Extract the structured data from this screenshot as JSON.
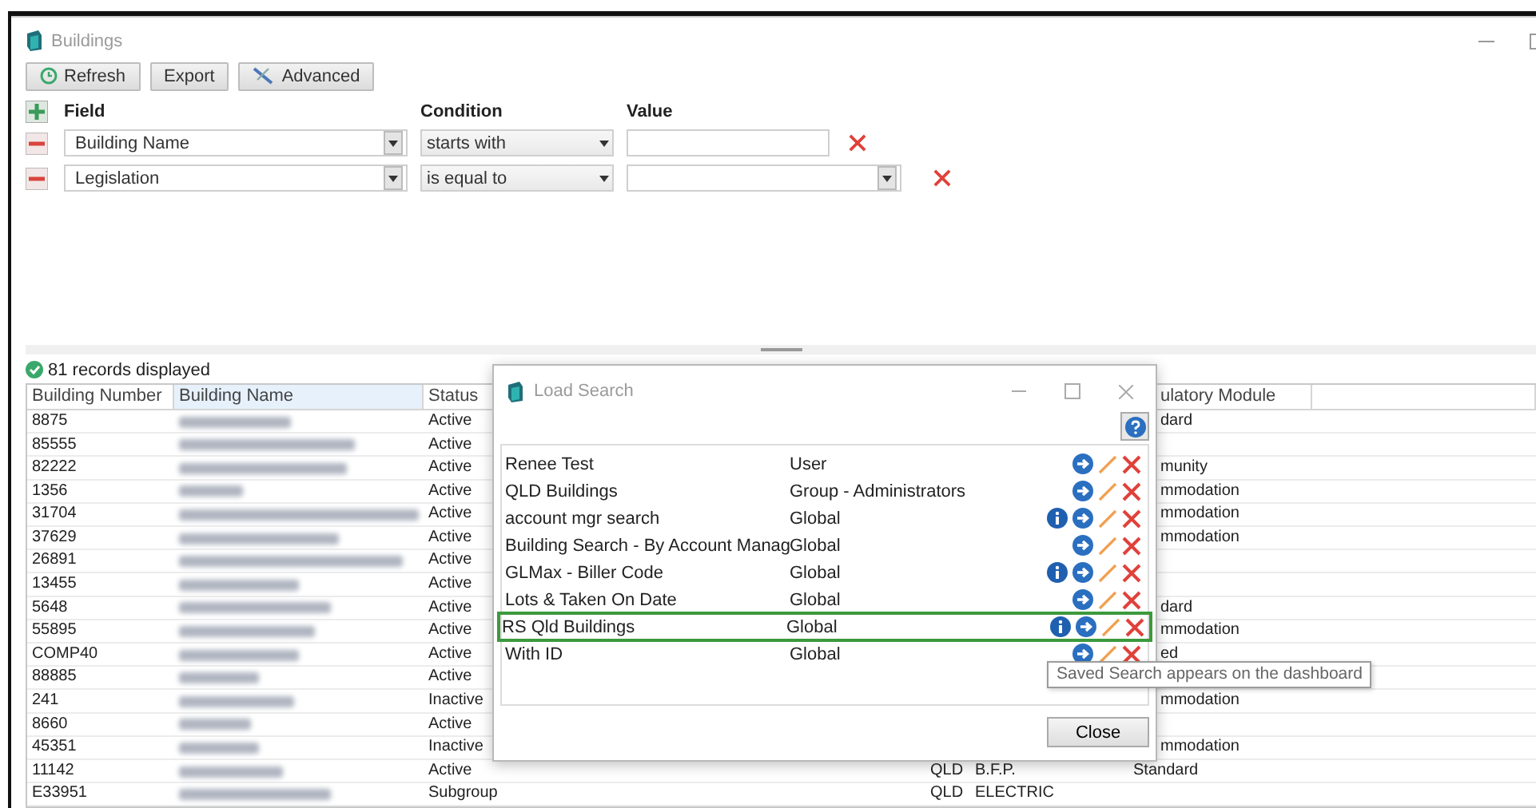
{
  "window": {
    "title": "Buildings"
  },
  "toolbar": [
    {
      "label": "Refresh",
      "kind": "refresh"
    },
    {
      "label": "Export",
      "kind": "plain"
    },
    {
      "label": "Advanced",
      "kind": "tools"
    }
  ],
  "filter": {
    "headers": {
      "field": "Field",
      "condition": "Condition",
      "value": "Value"
    },
    "rows": [
      {
        "field": "Building Name",
        "condition": "starts with",
        "kind": "text"
      },
      {
        "field": "Legislation",
        "condition": "is equal to",
        "kind": "dropdown"
      }
    ]
  },
  "status": "81 records displayed",
  "table": {
    "columns": {
      "building_number": "Building Number",
      "building_name": "Building Name",
      "status": "Status",
      "column_8": "ulatory Module"
    },
    "name_sorted": true,
    "rows": [
      {
        "building_number": "8875",
        "status": "Active",
        "column_8": "dard"
      },
      {
        "building_number": "85555",
        "status": "Active"
      },
      {
        "building_number": "82222",
        "status": "Active",
        "column_8": "munity"
      },
      {
        "building_number": "1356",
        "status": "Active",
        "column_8": "mmodation"
      },
      {
        "building_number": "31704",
        "status": "Active",
        "column_8": "mmodation"
      },
      {
        "building_number": "37629",
        "status": "Active",
        "column_8": "mmodation"
      },
      {
        "building_number": "26891",
        "status": "Active"
      },
      {
        "building_number": "13455",
        "status": "Active"
      },
      {
        "building_number": "5648",
        "status": "Active",
        "column_8": "dard"
      },
      {
        "building_number": "55895",
        "status": "Active",
        "column_8": "mmodation"
      },
      {
        "building_number": "COMP40",
        "status": "Active",
        "column_8": "ed"
      },
      {
        "building_number": "88885",
        "status": "Active"
      },
      {
        "building_number": "241",
        "status": "Inactive",
        "column_8": "mmodation"
      },
      {
        "building_number": "8660",
        "status": "Active"
      },
      {
        "building_number": "45351",
        "status": "Inactive",
        "column_8": "mmodation"
      },
      {
        "building_number": "11142",
        "status": "Active",
        "column_6": "QLD",
        "column_7": "B.F.P.",
        "column_8": "Standard"
      },
      {
        "building_number": "E33951",
        "status": "Subgroup",
        "column_6": "QLD",
        "column_7": "ELECTRIC"
      }
    ]
  },
  "dialog": {
    "title": "Load Search",
    "searches": [
      {
        "name": "Renee Test",
        "scope": "User",
        "info": false,
        "highlighted": false
      },
      {
        "name": "QLD Buildings",
        "scope": "Group - Administrators",
        "info": false,
        "highlighted": false
      },
      {
        "name": "account mgr search",
        "scope": "Global",
        "info": true,
        "highlighted": false
      },
      {
        "name": "Building Search - By Account Manag",
        "scope": "Global",
        "info": false,
        "highlighted": false
      },
      {
        "name": "GLMax - Biller Code",
        "scope": "Global",
        "info": true,
        "highlighted": false
      },
      {
        "name": "Lots & Taken On Date",
        "scope": "Global",
        "info": false,
        "highlighted": false
      },
      {
        "name": "RS Qld Buildings",
        "scope": "Global",
        "info": true,
        "highlighted": true
      },
      {
        "name": "With ID",
        "scope": "Global",
        "info": false,
        "highlighted": false
      }
    ],
    "close": "Close"
  },
  "tooltip": "Saved Search appears on the dashboard"
}
